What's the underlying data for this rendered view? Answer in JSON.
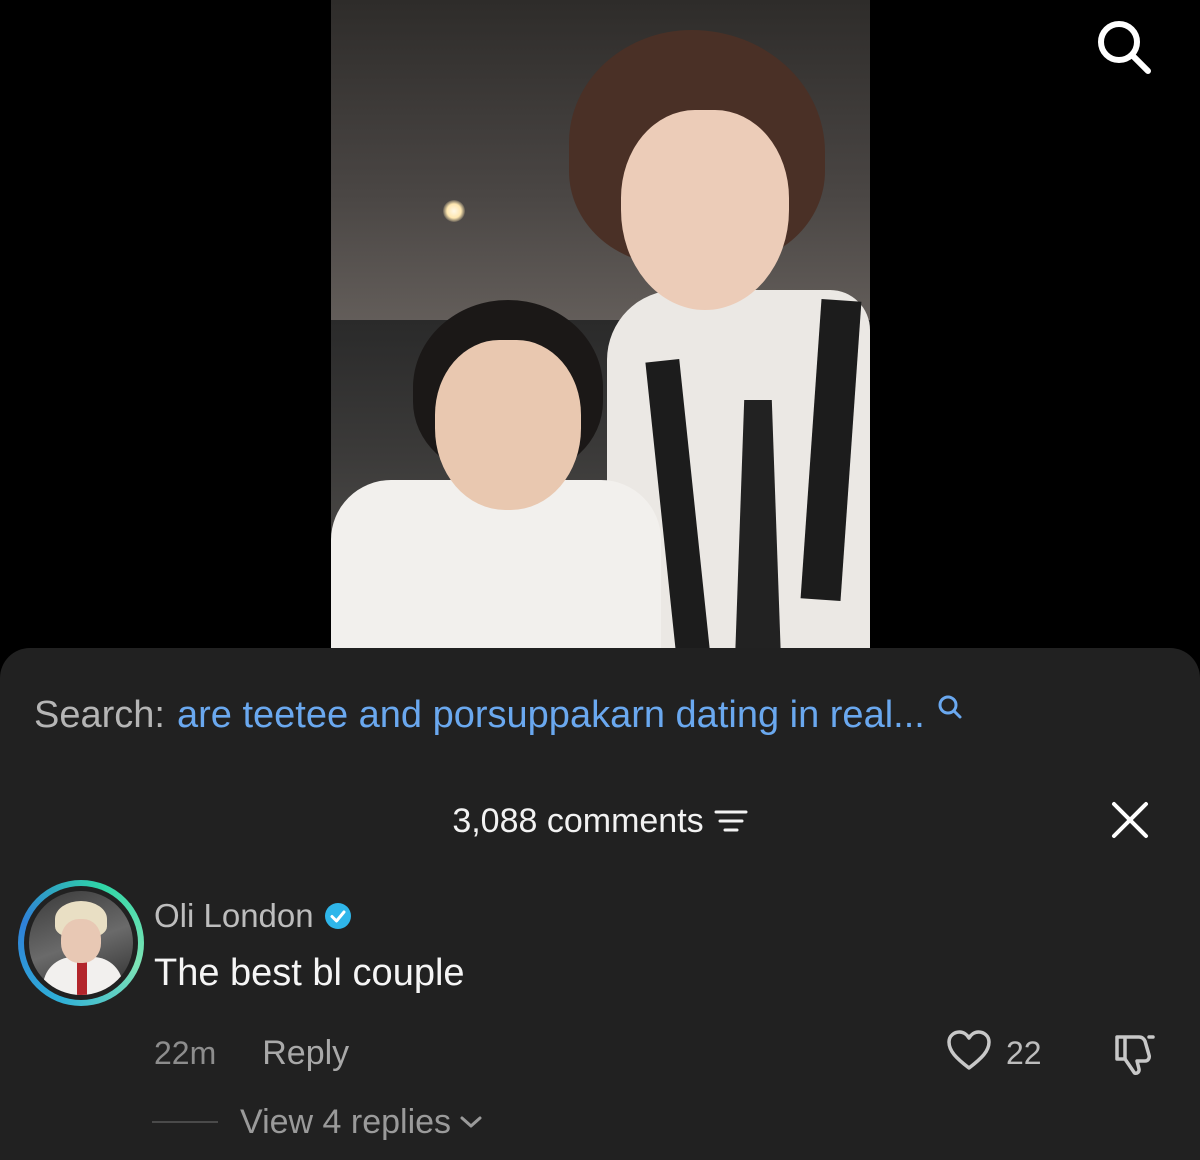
{
  "video": {
    "top_icon": "search-icon"
  },
  "search_suggestion": {
    "prefix": "Search:",
    "query": "are teetee and porsuppakarn dating in real...",
    "icon": "search-icon",
    "accent_color": "#6aa8ef"
  },
  "comments_panel": {
    "count_label": "3,088 comments",
    "sort_icon": "filter-icon",
    "close_icon": "close-icon",
    "background": "#212121"
  },
  "comment": {
    "username": "Oli London",
    "verified": true,
    "verified_color": "#2fb6ea",
    "text": "The best bl couple",
    "time": "22m",
    "reply_label": "Reply",
    "like_count": "22",
    "like_icon": "heart-icon",
    "dislike_icon": "thumbs-down-icon",
    "view_replies_label": "View 4 replies"
  }
}
